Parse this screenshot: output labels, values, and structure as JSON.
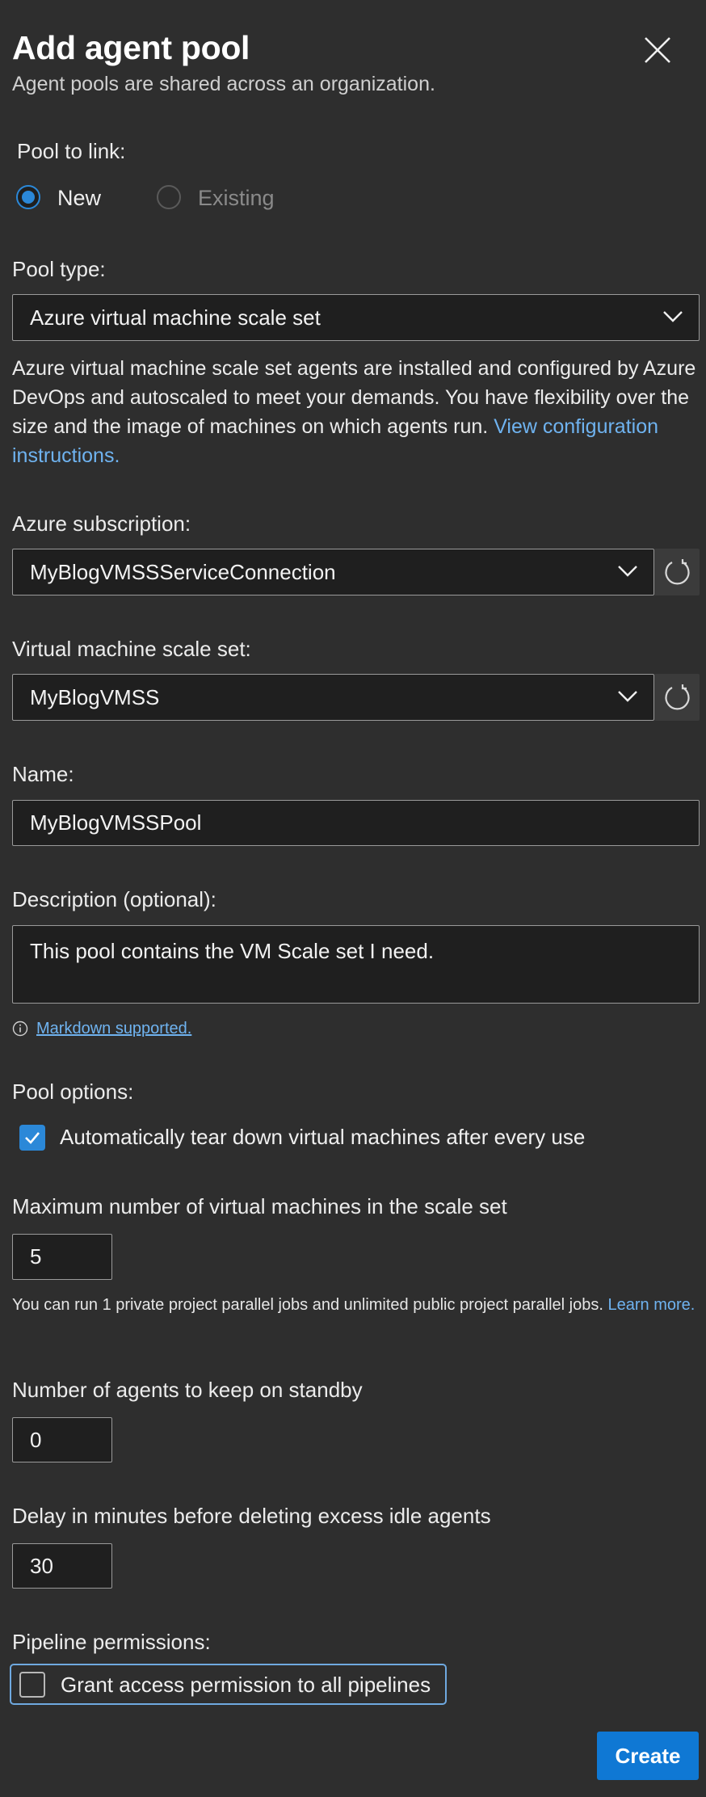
{
  "header": {
    "title": "Add agent pool",
    "subtitle": "Agent pools are shared across an organization."
  },
  "pool_to_link": {
    "label": "Pool to link:",
    "options": [
      {
        "label": "New",
        "selected": true
      },
      {
        "label": "Existing",
        "selected": false
      }
    ]
  },
  "pool_type": {
    "label": "Pool type:",
    "value": "Azure virtual machine scale set",
    "description": "Azure virtual machine scale set agents are installed and configured by Azure DevOps and autoscaled to meet your demands. You have flexibility over the size and the image of machines on which agents run.",
    "link_text": "View configuration instructions."
  },
  "azure_subscription": {
    "label": "Azure subscription:",
    "value": "MyBlogVMSSServiceConnection"
  },
  "scale_set": {
    "label": "Virtual machine scale set:",
    "value": "MyBlogVMSS"
  },
  "name": {
    "label": "Name:",
    "value": "MyBlogVMSSPool"
  },
  "description": {
    "label": "Description (optional):",
    "value": "This pool contains the VM Scale set I need.",
    "markdown_note": "Markdown supported."
  },
  "pool_options": {
    "label": "Pool options:",
    "teardown_label": "Automatically tear down virtual machines after every use",
    "teardown_checked": true
  },
  "max_vms": {
    "label": "Maximum number of virtual machines in the scale set",
    "value": "5",
    "note": "You can run 1 private project parallel jobs and unlimited public project parallel jobs.",
    "learn_more": "Learn more."
  },
  "standby": {
    "label": "Number of agents to keep on standby",
    "value": "0"
  },
  "delay": {
    "label": "Delay in minutes before deleting excess idle agents",
    "value": "30"
  },
  "pipeline_permissions": {
    "label": "Pipeline permissions:",
    "grant_label": "Grant access permission to all pipelines",
    "grant_checked": false
  },
  "footer": {
    "create_label": "Create"
  },
  "colors": {
    "background": "#2e2e2e",
    "field_background": "#1f1f1f",
    "accent": "#0f78d4",
    "link": "#6fb3f0"
  },
  "icons": [
    "close-icon",
    "chevron-down-icon",
    "refresh-icon",
    "info-icon",
    "checkmark-icon"
  ]
}
